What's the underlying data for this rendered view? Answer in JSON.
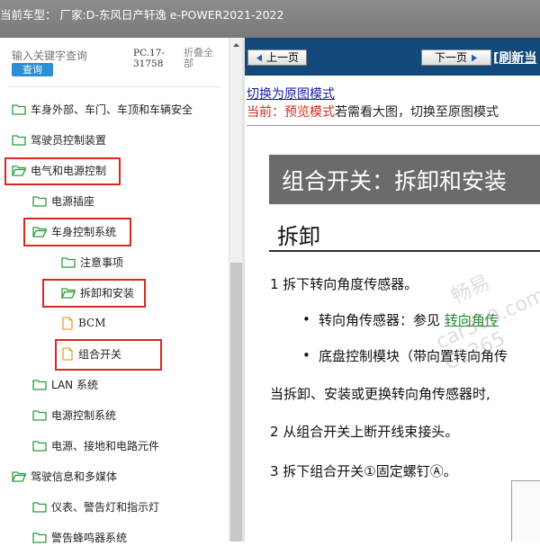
{
  "titlebar": {
    "text": "当前车型：  厂家:D-东风日产轩逸 e-POWER2021-2022"
  },
  "sidebar": {
    "search_placeholder": "输入关键字查询",
    "search_button": "查询",
    "pc_code": "PC.17-31758",
    "collapse_all": "折叠全部",
    "items": [
      {
        "label": "车身外部、车门、车顶和车辆安全"
      },
      {
        "label": "驾驶员控制装置"
      },
      {
        "label": "电气和电源控制"
      },
      {
        "label": "电源插座"
      },
      {
        "label": "车身控制系统"
      },
      {
        "label": "注意事项"
      },
      {
        "label": "拆卸和安装"
      },
      {
        "label": "BCM"
      },
      {
        "label": "组合开关"
      },
      {
        "label": "LAN 系统"
      },
      {
        "label": "电源控制系统"
      },
      {
        "label": "电源、接地和电路元件"
      },
      {
        "label": "驾驶信息和多媒体"
      },
      {
        "label": "仪表、警告灯和指示灯"
      },
      {
        "label": "警告蜂鸣器系统"
      }
    ]
  },
  "nav": {
    "prev": "上一页",
    "next": "下一页",
    "refresh": "[刷新当"
  },
  "content": {
    "switch_link": "切换为原图模式",
    "preview_prefix": "当前：预览模式",
    "preview_suffix": "若需看大图，切换至原图模式",
    "doc_title": "组合开关：拆卸和安装",
    "section": "拆卸",
    "step1": "1 拆下转向角度传感器。",
    "bullet1_prefix": "转向角传感器：参见 ",
    "bullet1_link": "转向角传",
    "bullet2": "底盘控制模块（带向置转向角传",
    "note": "当拆卸、安装或更换转向角传感器时,",
    "step2": "2 从组合开关上断开线束接头。",
    "step3": "3 拆下组合开关①固定螺钉Ⓐ。"
  },
  "colors": {
    "highlight": "#d9281f",
    "nav_bg": "#12487a",
    "folder": "#2e9a3c",
    "doc_folder": "#e8a23c"
  }
}
